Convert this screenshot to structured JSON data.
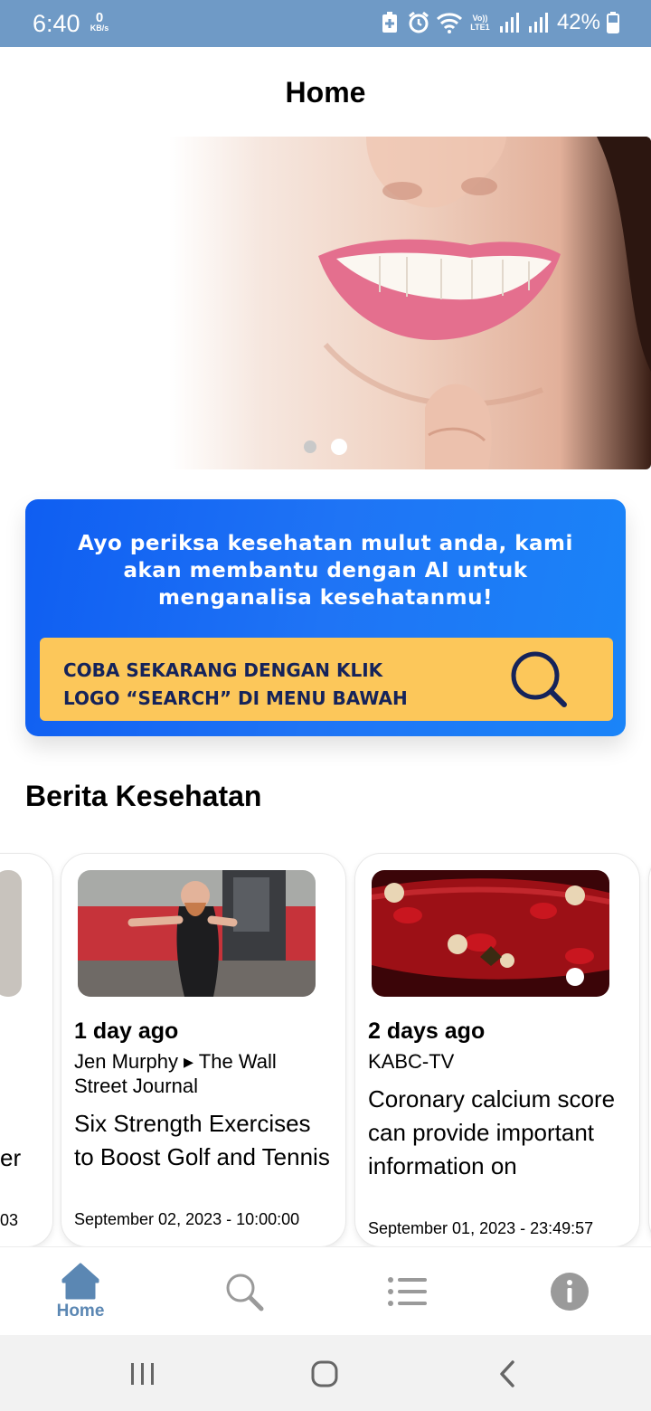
{
  "status_bar": {
    "time": "6:40",
    "net_speed_value": "0",
    "net_speed_unit": "KB/s",
    "network_label": "Vo)) LTE1",
    "battery_percent": "42%"
  },
  "header": {
    "title": "Home"
  },
  "hero": {
    "slide_count": 2,
    "active_slide": 2
  },
  "promo": {
    "message": "Ayo periksa kesehatan mulut anda, kami akan membantu dengan AI untuk menganalisa kesehatanmu!",
    "cta_line1": "COBA SEKARANG DENGAN KLIK",
    "cta_line2": "LOGO “SEARCH” DI MENU BAWAH"
  },
  "news": {
    "section_title": "Berita Kesehatan",
    "partial_card": {
      "title_fragment": "er",
      "date_fragment": "03"
    },
    "items": [
      {
        "age": "1 day ago",
        "source": "Jen Murphy ▸ The Wall Street Journal",
        "title": "Six Strength Exercises to Boost Golf and Tennis",
        "date": "September 02, 2023 - 10:00:00"
      },
      {
        "age": "2 days ago",
        "source": "KABC-TV",
        "title": "Coronary calcium score can provide important information on",
        "date": "September 01, 2023 - 23:49:57"
      }
    ]
  },
  "bottom_nav": {
    "items": [
      {
        "icon": "home-icon",
        "label": "Home",
        "active": true
      },
      {
        "icon": "search-icon",
        "label": "",
        "active": false
      },
      {
        "icon": "list-icon",
        "label": "",
        "active": false
      },
      {
        "icon": "info-icon",
        "label": "",
        "active": false
      }
    ]
  },
  "colors": {
    "status_bar": "#6f9ac6",
    "promo_blue": "#1f74f5",
    "promo_cta": "#fcc75a",
    "nav_active": "#5b87b3",
    "nav_inactive": "#9a9a9a"
  }
}
